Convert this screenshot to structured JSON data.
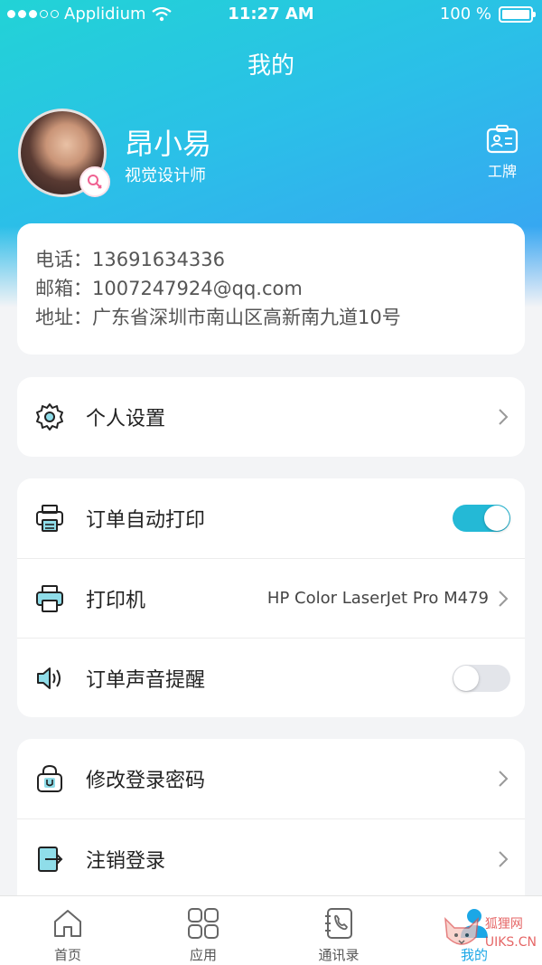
{
  "status_bar": {
    "carrier": "Applidium",
    "time": "11:27 AM",
    "battery": "100 %"
  },
  "header": {
    "title": "我的",
    "badge_label": "工牌"
  },
  "profile": {
    "name": "昂小易",
    "role": "视觉设计师"
  },
  "contact": {
    "phone": "电话：13691634336",
    "email": "邮箱：1007247924@qq.com",
    "address": "地址：广东省深圳市南山区高新南九道10号"
  },
  "settings": {
    "personal_label": "个人设置"
  },
  "printing": {
    "auto_print_label": "订单自动打印",
    "auto_print_on": true,
    "printer_label": "打印机",
    "printer_value": "HP Color LaserJet Pro M479",
    "sound_label": "订单声音提醒",
    "sound_on": false
  },
  "account": {
    "change_password_label": "修改登录密码",
    "logout_label": "注销登录"
  },
  "tabbar": {
    "tabs": [
      {
        "label": "首页",
        "icon": "home-icon"
      },
      {
        "label": "应用",
        "icon": "apps-icon"
      },
      {
        "label": "通讯录",
        "icon": "contacts-icon"
      },
      {
        "label": "我的",
        "icon": "profile-icon",
        "active": true
      }
    ]
  },
  "watermark": {
    "line1": "狐狸网",
    "line2": "UIKS.CN"
  },
  "colors": {
    "accent": "#24b9d6",
    "gradient_start": "#22d3d6",
    "gradient_end": "#3b9ef5",
    "tab_active": "#1ba7e6"
  }
}
